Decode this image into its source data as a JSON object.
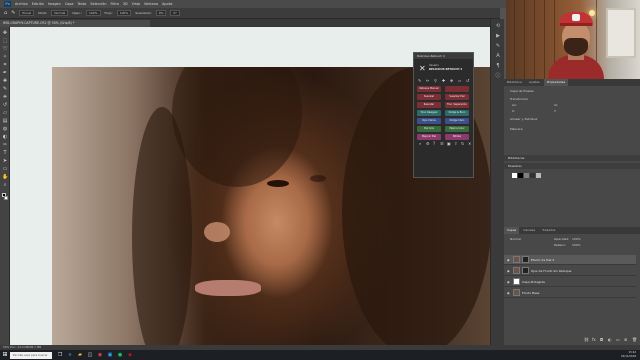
{
  "app": {
    "menu": [
      "Ps",
      "Archivo",
      "Edición",
      "Imagen",
      "Capa",
      "Texto",
      "Selección",
      "Filtro",
      "3D",
      "Vista",
      "Ventana",
      "Ayuda"
    ],
    "options": {
      "tool": "Pincel",
      "mode_label": "Modo:",
      "mode_value": "Normal",
      "opacity_label": "Opac.:",
      "opacity_value": "100%",
      "flow_label": "Flujo:",
      "flow_value": "100%",
      "smoothing_label": "Suavizado:",
      "smoothing_value": "0%",
      "angle_value": "0°"
    },
    "document_tab": "IMG-GRAPHY-CAPTURE.CR2 @ 50% (Gris/8) *",
    "status_text": "50%    Doc: 24,0 MB/96,7 MB"
  },
  "plugin": {
    "title": "Delicious Retouch 4",
    "brand_line1": "Usuario",
    "brand_line2": "DELICIOUS RETOUCH 4",
    "buttons": [
      {
        "label": "Retoque Manual",
        "color": "#7a2f35"
      },
      {
        "label": "",
        "color": "#7a2f35"
      },
      {
        "label": "Suavizar",
        "color": "#7a2f35"
      },
      {
        "label": "Suavizar Piel",
        "color": "#7a2f35"
      },
      {
        "label": "Rescatar",
        "color": "#7a2f35"
      },
      {
        "label": "Frec. Separación",
        "color": "#7a2f35"
      },
      {
        "label": "Tono Desigual",
        "color": "#2e6a6a"
      },
      {
        "label": "Dodge & Burn",
        "color": "#2e6a6a"
      },
      {
        "label": "Ojos Claros",
        "color": "#3c4f8a"
      },
      {
        "label": "Dodge Claro",
        "color": "#3c4f8a"
      },
      {
        "label": "Piel Gris",
        "color": "#3a6b3c"
      },
      {
        "label": "Mejora Color",
        "color": "#3a6b3c"
      },
      {
        "label": "Mejorar Piel",
        "color": "#8a3a6b"
      },
      {
        "label": "Nitidez",
        "color": "#8a3a6b"
      }
    ],
    "icons": [
      "search-icon",
      "gear-icon",
      "help-icon",
      "list-icon",
      "image-icon",
      "export-icon",
      "reset-icon",
      "close-icon"
    ]
  },
  "panels": {
    "top_tabs": [
      "Biblioteca",
      "Ajustes",
      "Propiedades"
    ],
    "properties_header": "Capa de Píxeles",
    "transform_label": "Transformar",
    "transform_fields": [
      "An:",
      "Al:",
      "X:",
      "Y:"
    ],
    "align_label": "Alinear y distribuir",
    "mask_label": "Máscara",
    "swatches_header": "Muestras",
    "library_header": "Bibliotecas",
    "layers_tabs": [
      "Capas",
      "Canales",
      "Trazados"
    ],
    "blend_mode": "Normal",
    "opacity_label": "Opacidad:",
    "opacity_value": "100%",
    "fill_label": "Relleno:",
    "fill_value": "100%",
    "layers": [
      {
        "name": "Efecto de Piel 2",
        "selected": true,
        "kind": "photo"
      },
      {
        "name": "Ojos de Fondo Sin Retoque",
        "selected": false,
        "kind": "dark"
      },
      {
        "name": "Capa Protegida",
        "selected": false,
        "kind": "mask"
      },
      {
        "name": "Fondo Base",
        "selected": false,
        "kind": "photo"
      }
    ]
  },
  "taskbar": {
    "search_placeholder": "Escribe aquí para buscar",
    "time": "15:42",
    "date": "02/11/2018"
  },
  "colors": {
    "ui_dark": "#3c3c3c",
    "ui_mid": "#484848",
    "accent": "#31a8ff",
    "canvas_bg": "#e8eeeb"
  }
}
